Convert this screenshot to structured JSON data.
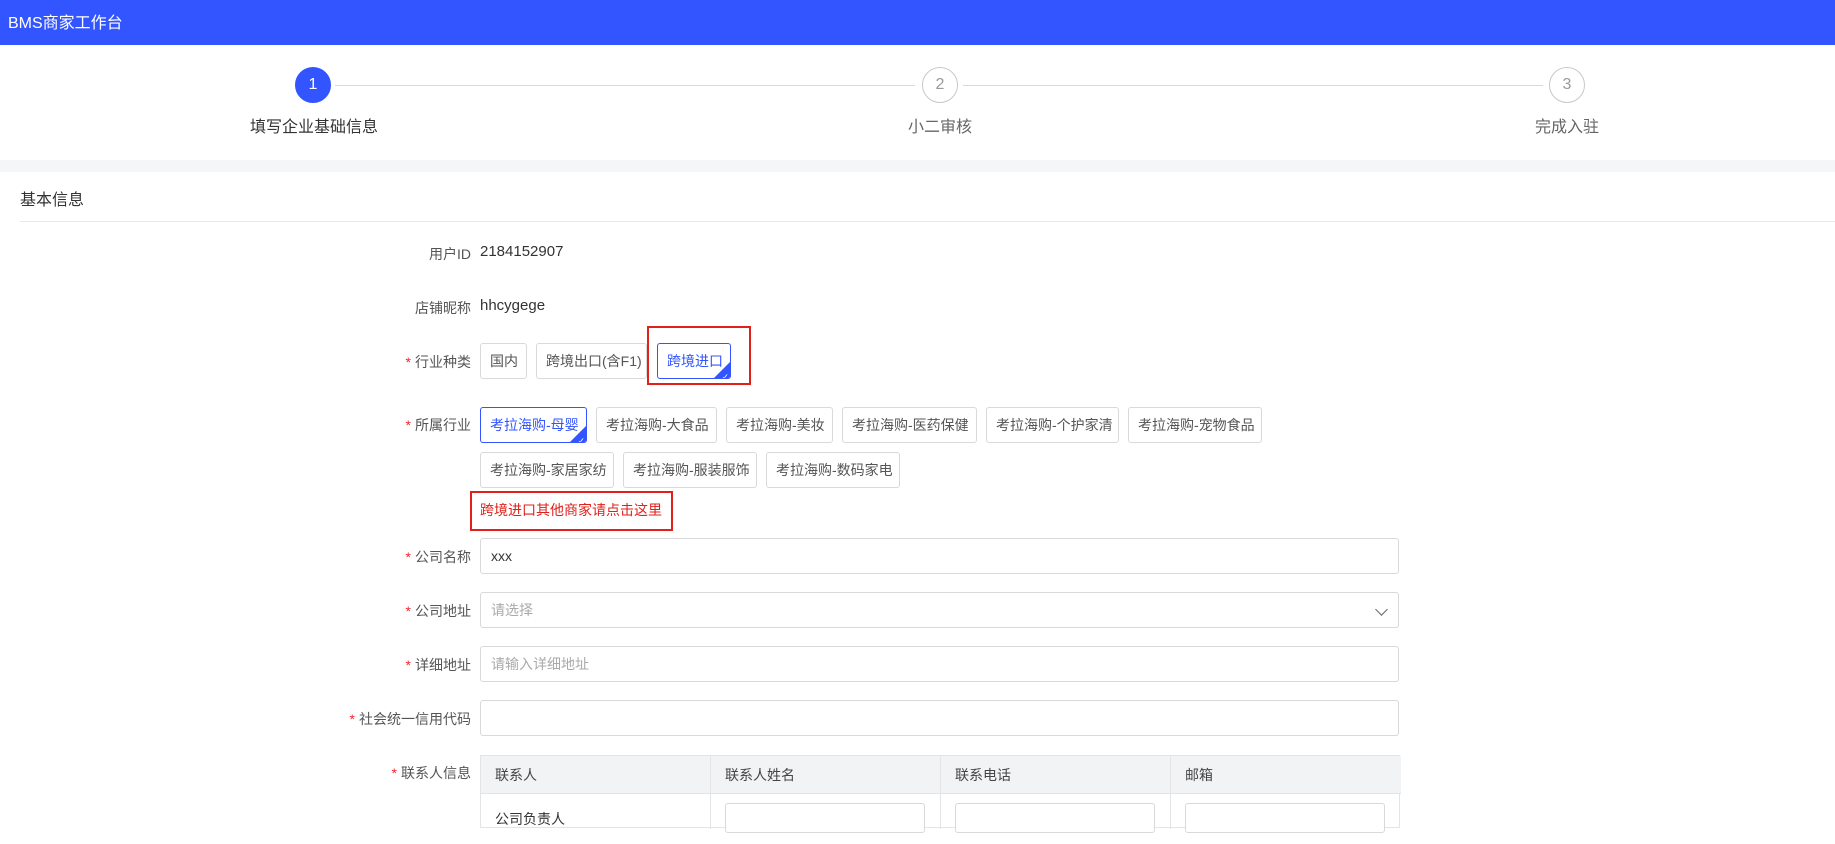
{
  "app": {
    "title": "BMS商家工作台"
  },
  "steps": [
    {
      "number": "1",
      "label": "填写企业基础信息"
    },
    {
      "number": "2",
      "label": "小二审核"
    },
    {
      "number": "3",
      "label": "完成入驻"
    }
  ],
  "section": {
    "title": "基本信息"
  },
  "form": {
    "user_id": {
      "label": "用户ID",
      "value": "2184152907"
    },
    "shop_nickname": {
      "label": "店铺昵称",
      "value": "hhcygege"
    },
    "industry_type": {
      "required_mark": "*",
      "label": "行业种类",
      "options": [
        "国内",
        "跨境出口(含F1)",
        "跨境进口"
      ],
      "selected": "跨境进口"
    },
    "industry": {
      "required_mark": "*",
      "label": "所属行业",
      "options": [
        "考拉海购-母婴",
        "考拉海购-大食品",
        "考拉海购-美妆",
        "考拉海购-医药保健",
        "考拉海购-个护家清",
        "考拉海购-宠物食品",
        "考拉海购-家居家纺",
        "考拉海购-服装服饰",
        "考拉海购-数码家电"
      ],
      "selected": "考拉海购-母婴",
      "other_link": "跨境进口其他商家请点击这里"
    },
    "company_name": {
      "required_mark": "*",
      "label": "公司名称",
      "value": "xxx"
    },
    "company_address": {
      "required_mark": "*",
      "label": "公司地址",
      "placeholder": "请选择"
    },
    "detail_address": {
      "required_mark": "*",
      "label": "详细地址",
      "placeholder": "请输入详细地址"
    },
    "credit_code": {
      "required_mark": "*",
      "label": "社会统一信用代码",
      "value": ""
    },
    "contacts": {
      "required_mark": "*",
      "label": "联系人信息",
      "columns": [
        "联系人",
        "联系人姓名",
        "联系电话",
        "邮箱"
      ],
      "rows": [
        {
          "role": "公司负责人"
        }
      ]
    }
  },
  "colors": {
    "brand": "#3355ff",
    "highlight": "#e0201b",
    "required": "#f5222d"
  }
}
